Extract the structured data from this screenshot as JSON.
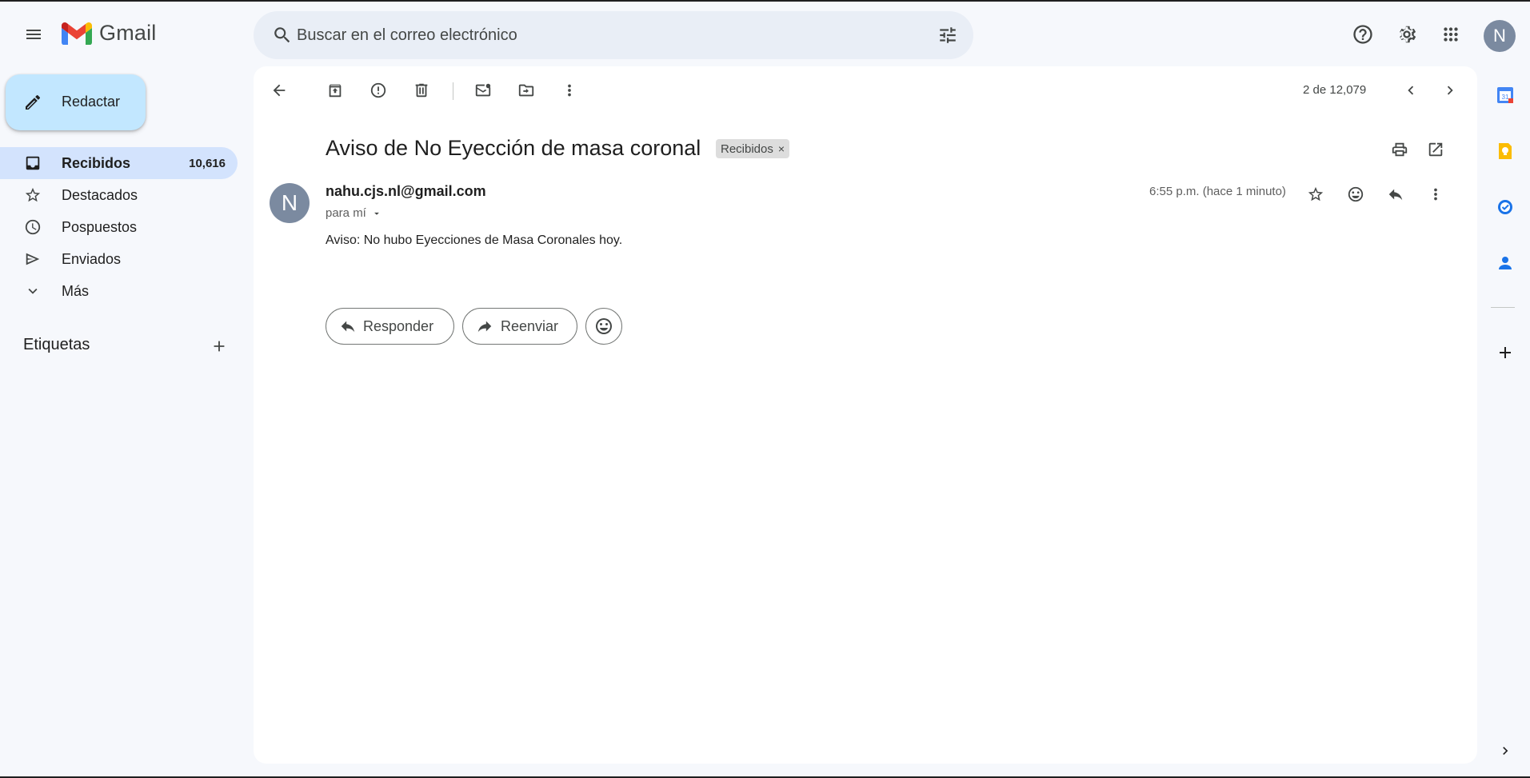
{
  "header": {
    "app_name": "Gmail",
    "search_placeholder": "Buscar en el correo electrónico",
    "avatar_letter": "N"
  },
  "sidebar": {
    "compose_label": "Redactar",
    "items": [
      {
        "label": "Recibidos",
        "count": "10,616",
        "icon": "inbox-icon",
        "active": true
      },
      {
        "label": "Destacados",
        "count": "",
        "icon": "star-icon",
        "active": false
      },
      {
        "label": "Pospuestos",
        "count": "",
        "icon": "clock-icon",
        "active": false
      },
      {
        "label": "Enviados",
        "count": "",
        "icon": "send-icon",
        "active": false
      },
      {
        "label": "Más",
        "count": "",
        "icon": "chevron-down-icon",
        "active": false
      }
    ],
    "labels_title": "Etiquetas"
  },
  "toolbar": {
    "pager": "2 de 12,079"
  },
  "message": {
    "subject": "Aviso de No Eyección de masa coronal",
    "label_chip": "Recibidos",
    "label_chip_close": "×",
    "sender_letter": "N",
    "sender_email": "nahu.cjs.nl@gmail.com",
    "to_line": "para mí",
    "time": "6:55 p.m. (hace 1 minuto)",
    "body": "Aviso: No hubo Eyecciones de Masa Coronales hoy.",
    "reply_label": "Responder",
    "forward_label": "Reenviar"
  },
  "colors": {
    "background": "#f6f8fc",
    "panel": "#ffffff",
    "compose": "#c2e7ff",
    "active_nav": "#d3e3fd",
    "search": "#e9eef6",
    "avatar": "#7b8aa0"
  }
}
